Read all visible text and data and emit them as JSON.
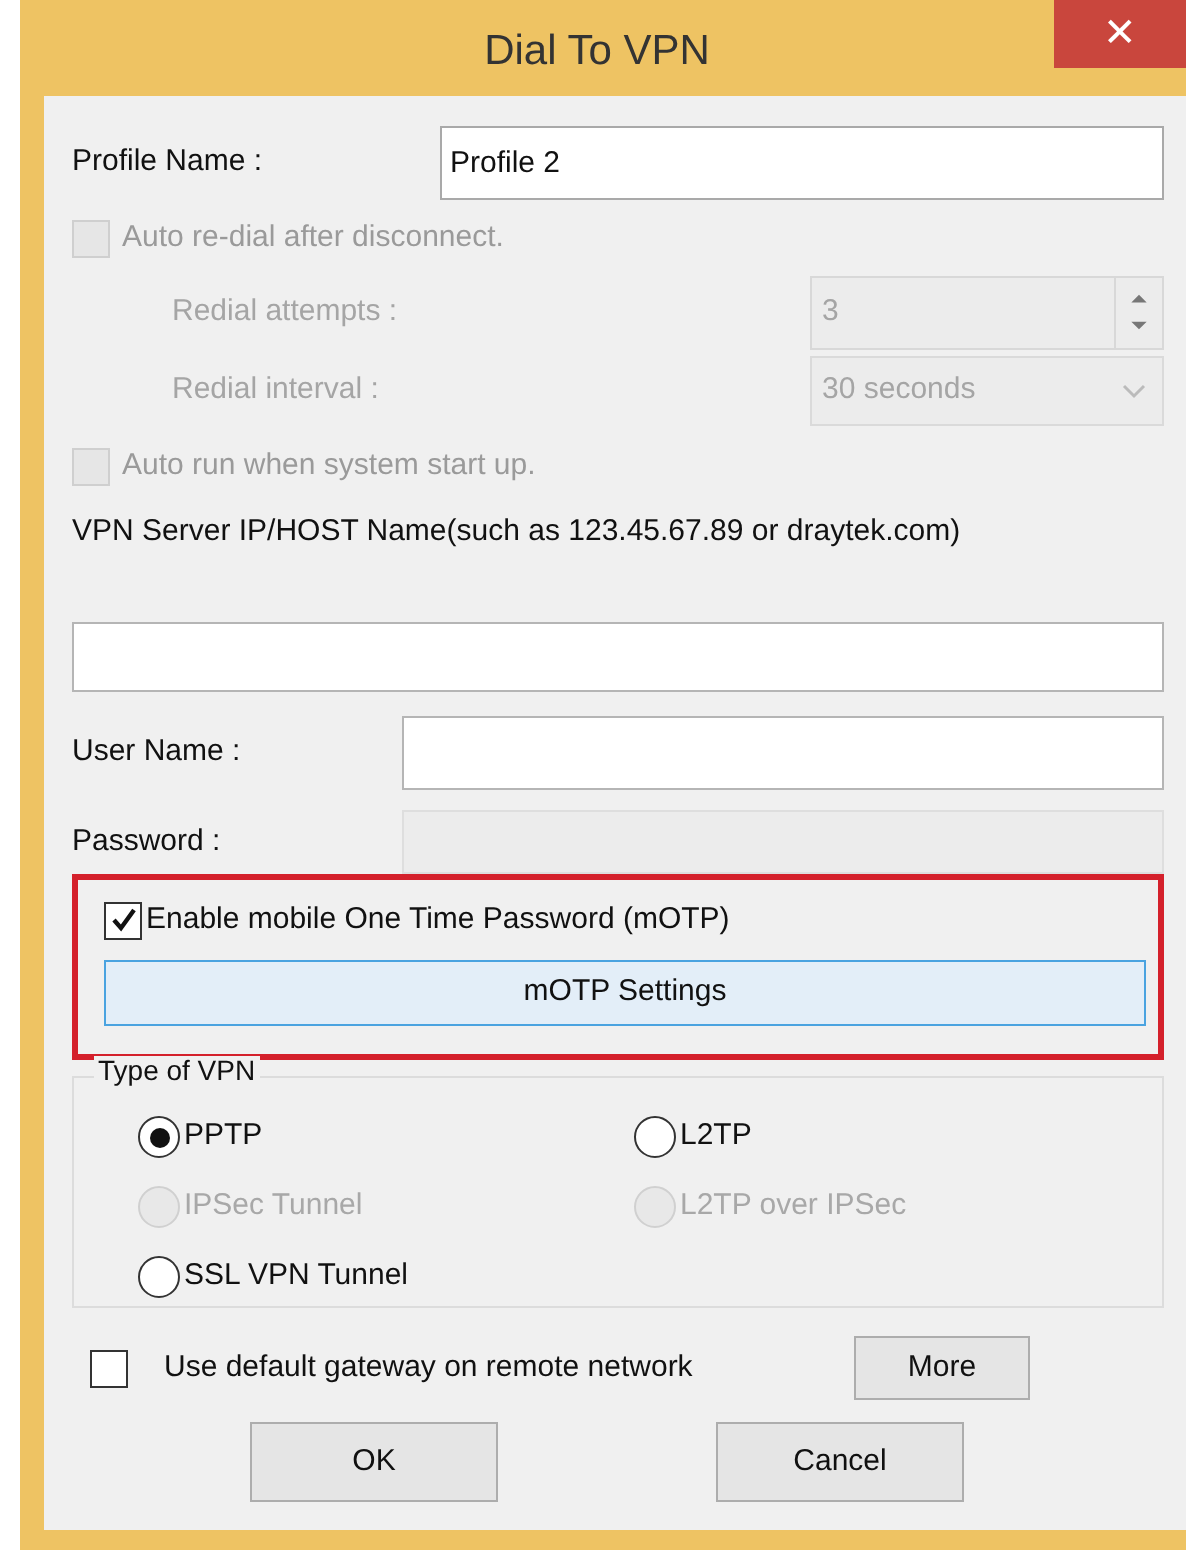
{
  "window": {
    "title": "Dial To VPN",
    "close": "✕"
  },
  "profile_name": {
    "label": "Profile Name :",
    "value": "Profile 2"
  },
  "auto_redial": {
    "label": "Auto re-dial after disconnect.",
    "checked": false,
    "disabled": true
  },
  "redial_attempts": {
    "label": "Redial attempts :",
    "value": "3",
    "disabled": true
  },
  "redial_interval": {
    "label": "Redial interval :",
    "value": "30 seconds",
    "disabled": true
  },
  "auto_run": {
    "label": "Auto run when system start up.",
    "checked": false,
    "disabled": true
  },
  "server": {
    "label": "VPN Server IP/HOST Name(such as 123.45.67.89 or draytek.com)"
  },
  "user_name": {
    "label": "User Name :",
    "disabled": false
  },
  "password": {
    "label": "Password :",
    "disabled": true
  },
  "motp": {
    "label": "Enable mobile One Time Password (mOTP)",
    "checked": true,
    "highlighted": true,
    "button": "mOTP Settings"
  },
  "vpn_type": {
    "legend": "Type of VPN",
    "options": [
      {
        "label": "PPTP",
        "selected": true,
        "disabled": false
      },
      {
        "label": "L2TP",
        "selected": false,
        "disabled": false
      },
      {
        "label": "IPSec Tunnel",
        "selected": false,
        "disabled": true
      },
      {
        "label": "L2TP over IPSec",
        "selected": false,
        "disabled": true
      },
      {
        "label": "SSL VPN Tunnel",
        "selected": false,
        "disabled": false
      }
    ]
  },
  "default_gateway": {
    "label": "Use default gateway on remote network",
    "checked": false,
    "disabled": false
  },
  "buttons": {
    "more": "More",
    "ok": "OK",
    "cancel": "Cancel"
  }
}
